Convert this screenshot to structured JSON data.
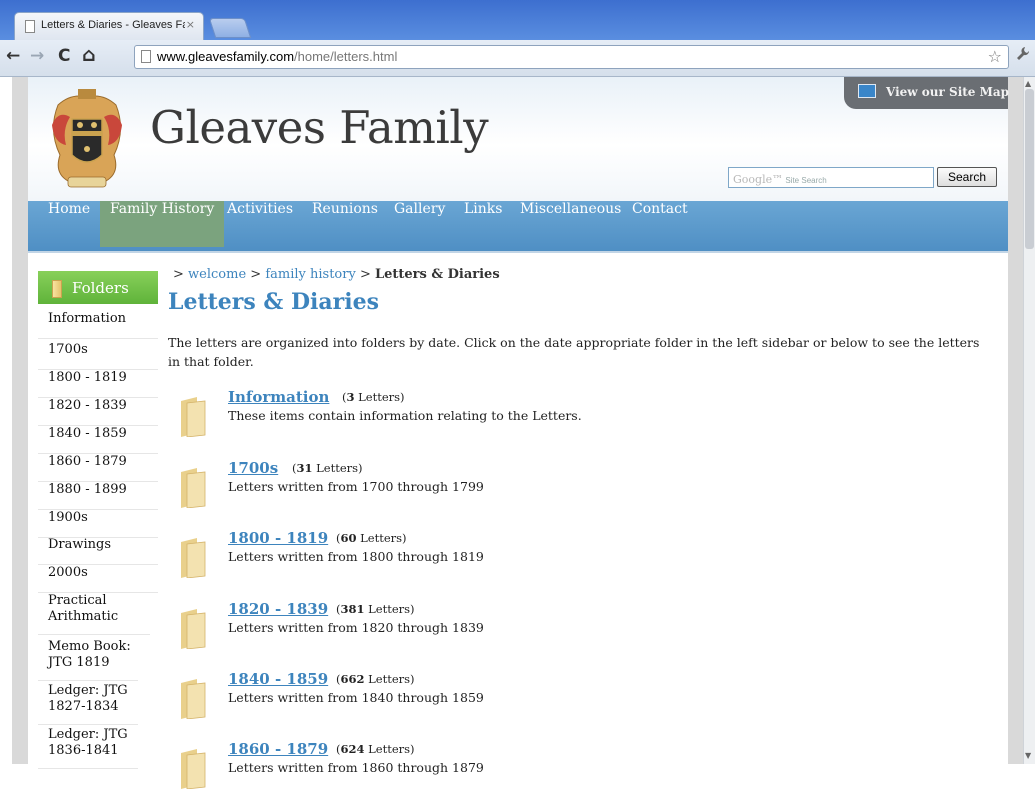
{
  "browser": {
    "tab_title": "Letters & Diaries - Gleaves Fa",
    "tab_close": "×",
    "url_host": "www.gleavesfamily.com",
    "url_path": "/home/letters.html",
    "back": "←",
    "forward": "→",
    "reload": "C",
    "home": "⌂",
    "star": "☆",
    "wrench": "🔧"
  },
  "header": {
    "site_title": "Gleaves Family",
    "sitemap_label": "View our Site Map",
    "search_placeholder_brand": "Google™",
    "search_placeholder_text": "Site Search",
    "search_button": "Search"
  },
  "nav": {
    "items": [
      {
        "label": "Home"
      },
      {
        "label": "Family History",
        "active": true
      },
      {
        "label": "Activities"
      },
      {
        "label": "Reunions"
      },
      {
        "label": "Gallery"
      },
      {
        "label": "Links"
      },
      {
        "label": "Miscellaneous"
      },
      {
        "label": "Contact"
      }
    ]
  },
  "sidebar": {
    "header": "Folders",
    "items": [
      {
        "label": "Information"
      },
      {
        "label": "1700s"
      },
      {
        "label": "1800 - 1819"
      },
      {
        "label": "1820 - 1839"
      },
      {
        "label": "1840 - 1859"
      },
      {
        "label": "1860 - 1879"
      },
      {
        "label": "1880 - 1899"
      },
      {
        "label": "1900s"
      },
      {
        "label": "Drawings"
      },
      {
        "label": "2000s"
      },
      {
        "label": "Practical Arithmatic"
      },
      {
        "label": "Memo Book: JTG 1819"
      },
      {
        "label": "Ledger: JTG 1827-1834"
      },
      {
        "label": "Ledger: JTG 1836-1841"
      }
    ]
  },
  "main": {
    "breadcrumb": {
      "sep1": "> ",
      "link1": "welcome",
      "sep2": " > ",
      "link2": "family history",
      "sep3": " > ",
      "current": "Letters & Diaries"
    },
    "heading": "Letters & Diaries",
    "intro": "The letters are organized into folders by date. Click on the date appropriate folder in the left sidebar or below to see the letters in that folder.",
    "folders": [
      {
        "title": "Information",
        "count": "3",
        "count_suffix": "Letters)",
        "desc": "These items contain information relating to the Letters."
      },
      {
        "title": "1700s",
        "count": "31",
        "count_suffix": "Letters)",
        "desc": "Letters written from 1700 through 1799"
      },
      {
        "title": "1800 - 1819",
        "count": "60",
        "count_suffix": "Letters)",
        "desc": "Letters written from 1800 through 1819"
      },
      {
        "title": "1820 - 1839",
        "count": "381",
        "count_suffix": "Letters)",
        "desc": "Letters written from 1820 through 1839"
      },
      {
        "title": "1840 - 1859",
        "count": "662",
        "count_suffix": "Letters)",
        "desc": "Letters written from 1840 through 1859"
      },
      {
        "title": "1860 - 1879",
        "count": "624",
        "count_suffix": "Letters)",
        "desc": "Letters written from 1860 through 1879"
      }
    ]
  }
}
